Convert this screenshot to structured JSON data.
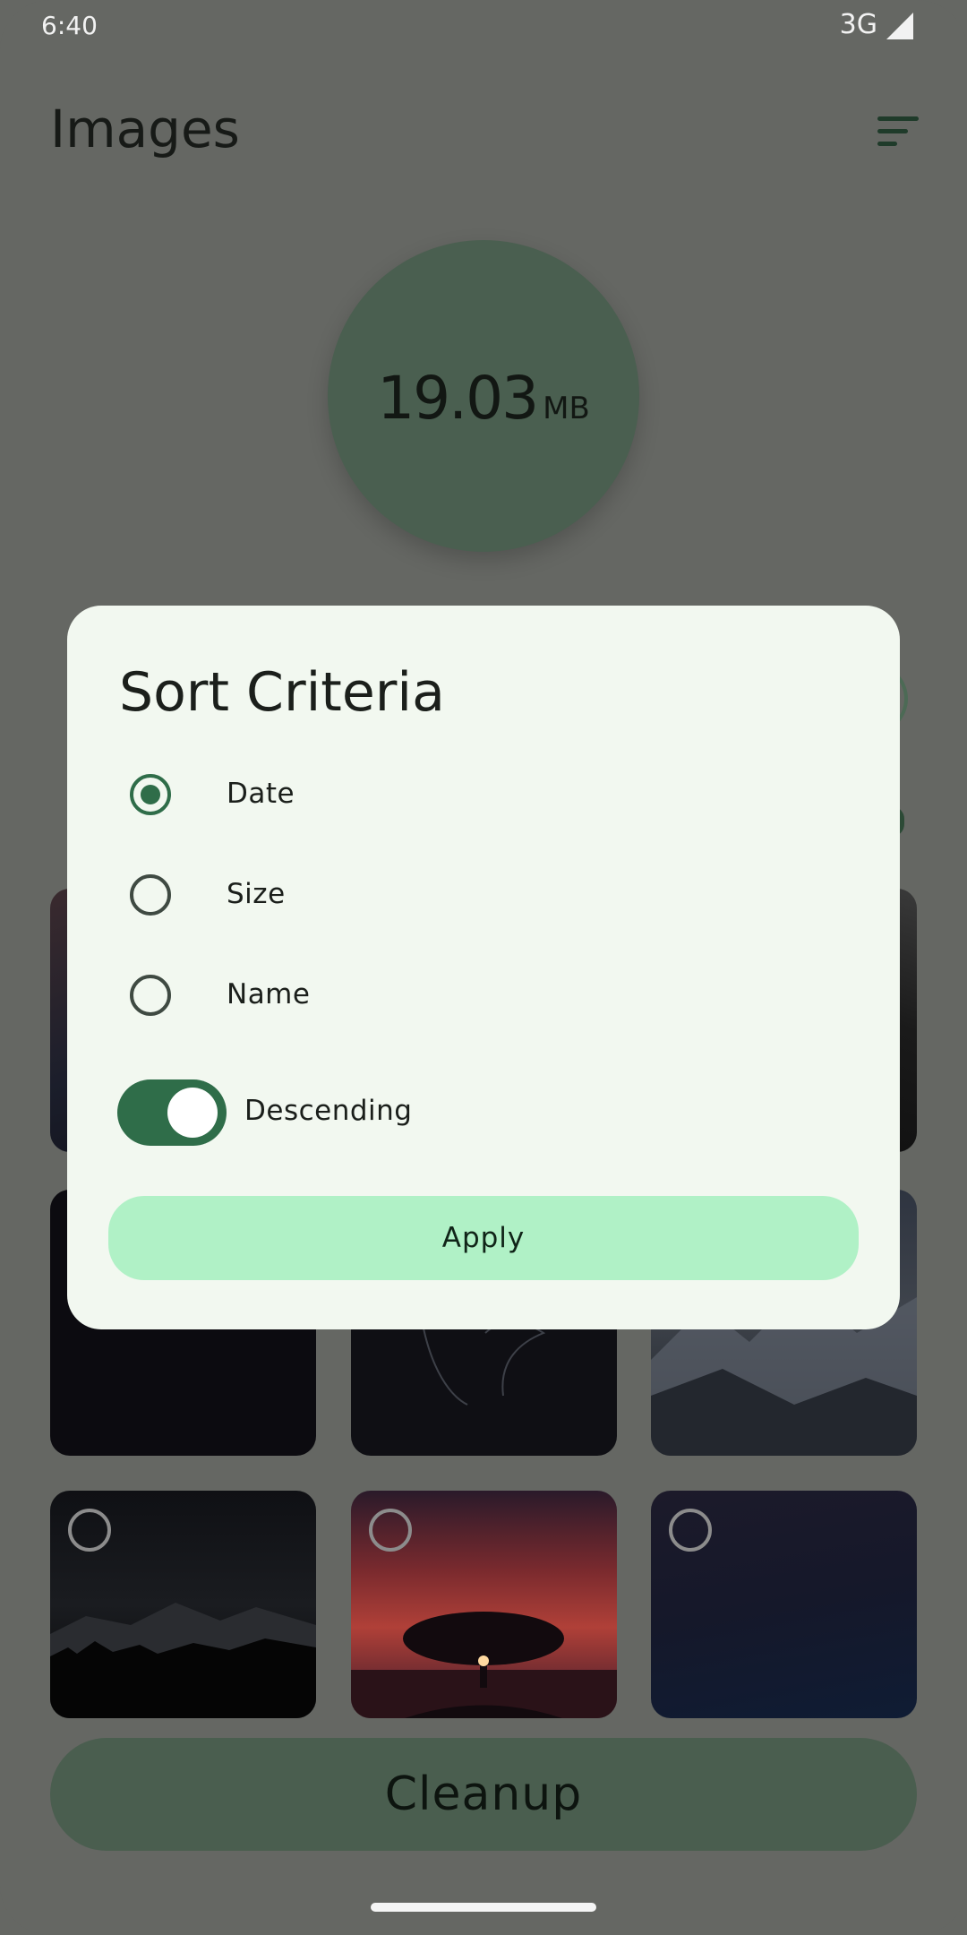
{
  "status_bar": {
    "time": "6:40",
    "network": "3G"
  },
  "header": {
    "title": "Images",
    "sort_icon": "sort-icon"
  },
  "storage": {
    "value": "19.03",
    "unit": "MB"
  },
  "dialog": {
    "title": "Sort Criteria",
    "options": [
      {
        "label": "Date",
        "selected": true
      },
      {
        "label": "Size",
        "selected": false
      },
      {
        "label": "Name",
        "selected": false
      }
    ],
    "descending": {
      "label": "Descending",
      "enabled": true
    },
    "apply_label": "Apply"
  },
  "footer": {
    "cleanup_label": "Cleanup"
  },
  "colors": {
    "accent": "#2f6d49",
    "apply_button": "#b0f1c6",
    "dialog_background": "#f2f8f0",
    "scrim": "#656763"
  }
}
